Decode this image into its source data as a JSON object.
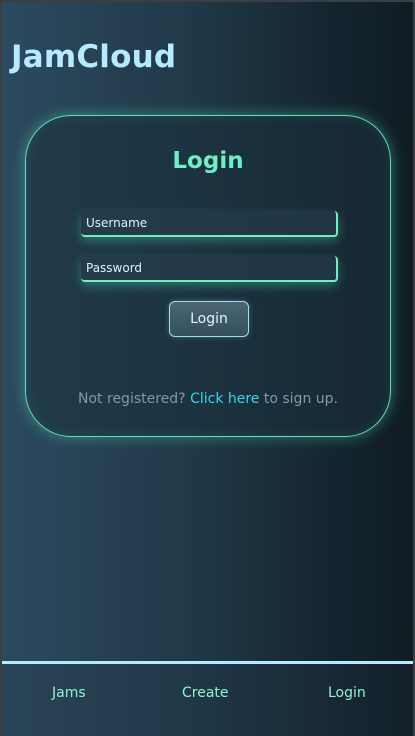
{
  "app": {
    "brand": "JamCloud"
  },
  "login_card": {
    "title": "Login",
    "username_placeholder": "Username",
    "password_placeholder": "Password",
    "submit_label": "Login",
    "signup_prefix": "Not registered? ",
    "signup_link": "Click here",
    "signup_suffix": " to sign up."
  },
  "navbar": {
    "items": [
      {
        "label": "Jams"
      },
      {
        "label": "Create"
      },
      {
        "label": "Login"
      }
    ]
  },
  "colors": {
    "brand": "#b5eaff",
    "accent": "#6ef0c4",
    "link": "#35d6f0"
  }
}
